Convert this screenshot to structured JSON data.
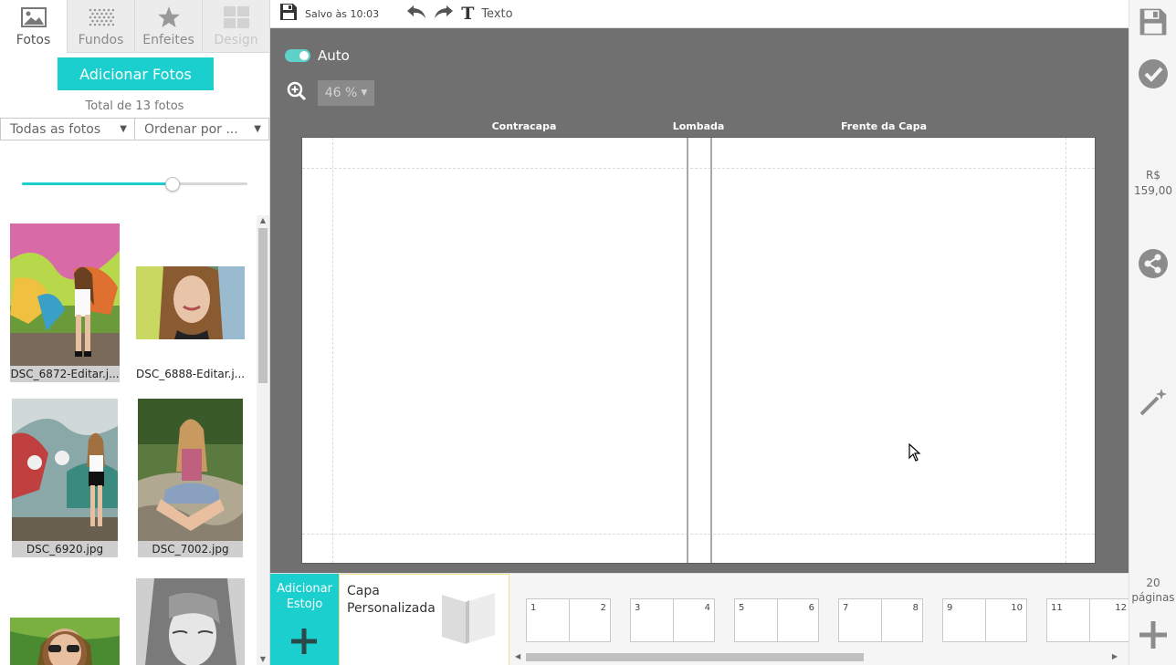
{
  "left_panel": {
    "tabs": [
      {
        "label": "Fotos",
        "icon": "image-icon",
        "state": "active"
      },
      {
        "label": "Fundos",
        "icon": "pattern-icon",
        "state": "normal"
      },
      {
        "label": "Enfeites",
        "icon": "star-icon",
        "state": "normal"
      },
      {
        "label": "Design",
        "icon": "layout-icon",
        "state": "disabled"
      }
    ],
    "add_photos_label": "Adicionar Fotos",
    "photos_total": "Total de 13 fotos",
    "filter_select": "Todas as fotos",
    "sort_select": "Ordenar por ...",
    "thumb_size": 0.67,
    "photos": [
      {
        "filename": "DSC_6872-Editar.j..."
      },
      {
        "filename": "DSC_6888-Editar.j..."
      },
      {
        "filename": "DSC_6920.jpg"
      },
      {
        "filename": "DSC_7002.jpg"
      },
      {
        "filename": ""
      },
      {
        "filename": ""
      }
    ]
  },
  "toolbar": {
    "saved_status": "Salvo às 10:03",
    "text_tool_label": "Texto",
    "text_tool_glyph": "T"
  },
  "canvas": {
    "auto_label": "Auto",
    "auto_enabled": true,
    "zoom_level": "46 %",
    "labels": {
      "back_cover": "Contracapa",
      "spine": "Lombada",
      "front_cover": "Frente da Capa"
    }
  },
  "right_sidebar": {
    "price_currency": "R$",
    "price_value": "159,00",
    "pages_number": "20",
    "pages_label": "páginas"
  },
  "bottom_strip": {
    "add_case_line1": "Adicionar",
    "add_case_line2": "Estojo",
    "cover_line1": "Capa",
    "cover_line2": "Personalizada",
    "spreads": [
      {
        "left": "1",
        "right": "2"
      },
      {
        "left": "3",
        "right": "4"
      },
      {
        "left": "5",
        "right": "6"
      },
      {
        "left": "7",
        "right": "8"
      },
      {
        "left": "9",
        "right": "10"
      },
      {
        "left": "11",
        "right": "12"
      }
    ]
  },
  "colors": {
    "accent": "#1ccfcf",
    "toggle": "#5fd1c8",
    "canvas_bg": "#707070"
  }
}
